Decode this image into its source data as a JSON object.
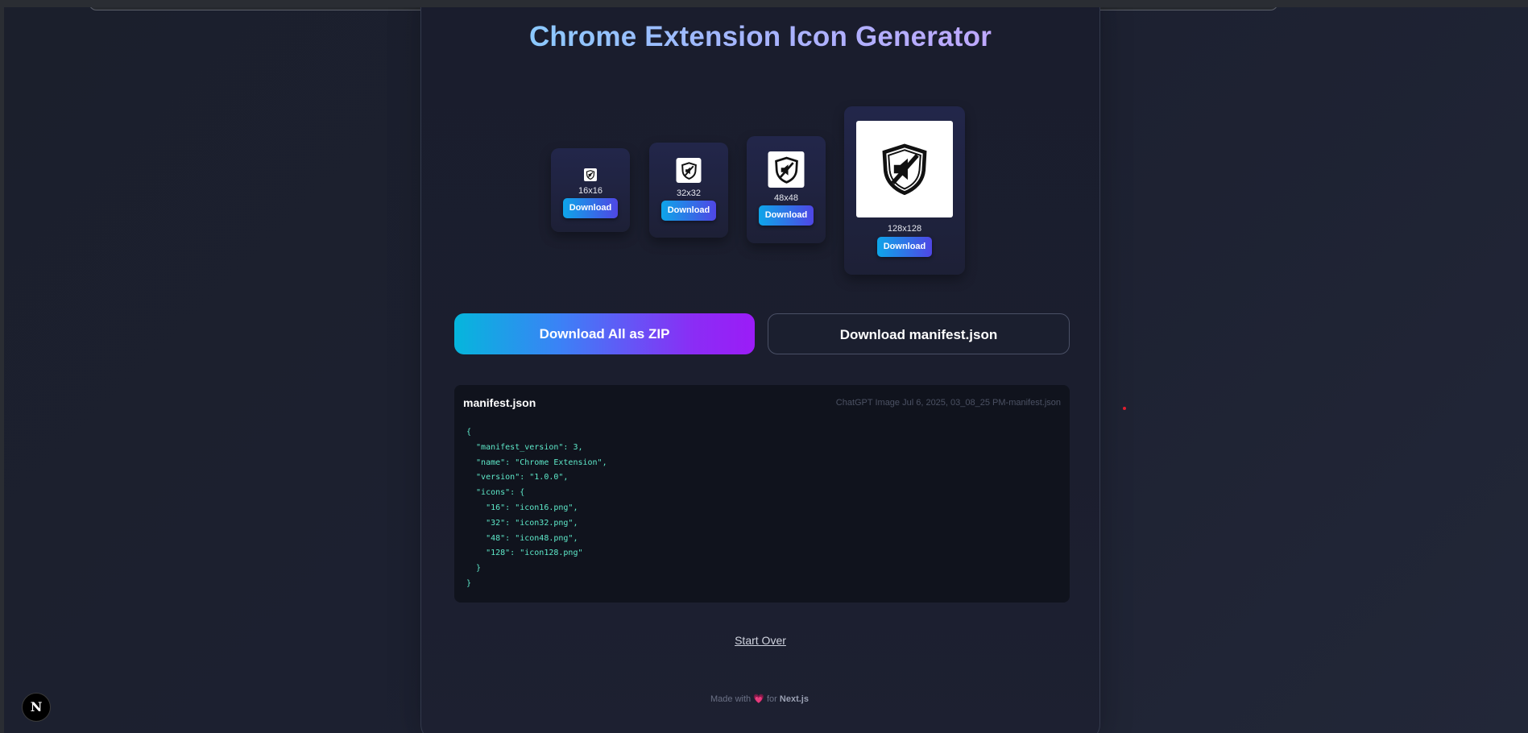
{
  "page": {
    "title": "Chrome Extension Icon Generator"
  },
  "icons": [
    {
      "size_label": "16x16",
      "download_label": "Download"
    },
    {
      "size_label": "32x32",
      "download_label": "Download"
    },
    {
      "size_label": "48x48",
      "download_label": "Download"
    },
    {
      "size_label": "128x128",
      "download_label": "Download"
    }
  ],
  "actions": {
    "zip_label": "Download All as ZIP",
    "manifest_label": "Download manifest.json"
  },
  "manifest_panel": {
    "title": "manifest.json",
    "filename": "ChatGPT Image Jul 6, 2025, 03_08_25 PM-manifest.json",
    "code": "{\n  \"manifest_version\": 3,\n  \"name\": \"Chrome Extension\",\n  \"version\": \"1.0.0\",\n  \"icons\": {\n    \"16\": \"icon16.png\",\n    \"32\": \"icon32.png\",\n    \"48\": \"icon48.png\",\n    \"128\": \"icon128.png\"\n  }\n}"
  },
  "start_over_label": "Start Over",
  "footer": {
    "made_with": "Made with",
    "heart": "💗",
    "for_text": "for",
    "framework": "Next.js"
  },
  "dev_badge": "N",
  "colors": {
    "accent_cyan": "#0ea5e9",
    "accent_indigo": "#4f46e5",
    "accent_purple": "#9b1cf7",
    "code_green": "#5ee9c9",
    "background": "#1c2030"
  },
  "icon_semantics": {
    "generated_icon": "shield-muted-speaker-icon",
    "dev_badge": "nextjs-logo-icon"
  }
}
